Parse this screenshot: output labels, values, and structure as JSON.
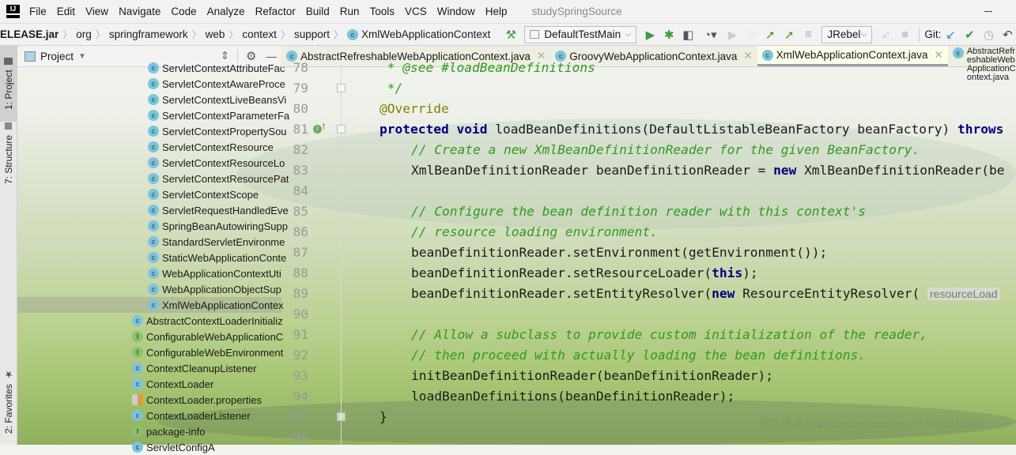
{
  "menubar": {
    "logo": "IJ",
    "items": [
      "File",
      "Edit",
      "View",
      "Navigate",
      "Code",
      "Analyze",
      "Refactor",
      "Build",
      "Run",
      "Tools",
      "VCS",
      "Window",
      "Help"
    ],
    "title": "studySpringSource"
  },
  "breadcrumb": [
    "ELEASE.jar",
    "org",
    "springframework",
    "web",
    "context",
    "support",
    "XmlWebApplicationContext"
  ],
  "toolbar": {
    "run_config": "DefaultTestMain",
    "jrebel": "JRebel",
    "git_label": "Git:",
    "icons": [
      "build-hammer-icon",
      "run-icon",
      "debug-icon",
      "coverage-icon",
      "profile-icon",
      "run-disabled-icon",
      "attach-icon",
      "jrebel-run-icon",
      "jrebel-debug-icon",
      "step-icon",
      "jrebel-rocket-icon",
      "stop-icon",
      "git-update-icon",
      "git-commit-icon",
      "history-icon",
      "rollback-icon"
    ]
  },
  "sidebar": {
    "tabs": [
      "1: Project",
      "7: Structure",
      "2: Favorites"
    ]
  },
  "project_panel": {
    "title": "Project",
    "tree": [
      {
        "label": "ServletContextAttributeFac",
        "type": "class",
        "level": 2
      },
      {
        "label": "ServletContextAwareProce",
        "type": "class",
        "level": 2
      },
      {
        "label": "ServletContextLiveBeansVi",
        "type": "class",
        "level": 2
      },
      {
        "label": "ServletContextParameterFa",
        "type": "class",
        "level": 2
      },
      {
        "label": "ServletContextPropertySou",
        "type": "class",
        "level": 2
      },
      {
        "label": "ServletContextResource",
        "type": "class",
        "level": 2
      },
      {
        "label": "ServletContextResourceLo",
        "type": "class",
        "level": 2
      },
      {
        "label": "ServletContextResourcePat",
        "type": "class",
        "level": 2
      },
      {
        "label": "ServletContextScope",
        "type": "class",
        "level": 2
      },
      {
        "label": "ServletRequestHandledEve",
        "type": "class",
        "level": 2
      },
      {
        "label": "SpringBeanAutowiringSupp",
        "type": "class",
        "level": 2
      },
      {
        "label": "StandardServletEnvironme",
        "type": "class",
        "level": 2
      },
      {
        "label": "StaticWebApplicationConte",
        "type": "class",
        "level": 2
      },
      {
        "label": "WebApplicationContextUti",
        "type": "class",
        "level": 2
      },
      {
        "label": "WebApplicationObjectSup",
        "type": "class",
        "level": 2
      },
      {
        "label": "XmlWebApplicationContex",
        "type": "class",
        "level": 2,
        "selected": true
      },
      {
        "label": "AbstractContextLoaderInitializ",
        "type": "class",
        "level": 1
      },
      {
        "label": "ConfigurableWebApplicationC",
        "type": "interface",
        "level": 1
      },
      {
        "label": "ConfigurableWebEnvironment",
        "type": "interface",
        "level": 1
      },
      {
        "label": "ContextCleanupListener",
        "type": "class",
        "level": 1
      },
      {
        "label": "ContextLoader",
        "type": "class",
        "level": 1
      },
      {
        "label": "ContextLoader.properties",
        "type": "properties",
        "level": 1
      },
      {
        "label": "ContextLoaderListener",
        "type": "class",
        "level": 1
      },
      {
        "label": "package-info",
        "type": "interface",
        "level": 1
      },
      {
        "label": "ServletConfigA",
        "type": "class",
        "level": 1
      }
    ]
  },
  "editor_tabs": [
    {
      "label": "AbstractRefreshableWebApplicationContext.java",
      "active": false
    },
    {
      "label": "GroovyWebApplicationContext.java",
      "active": false
    },
    {
      "label": "XmlWebApplicationContext.java",
      "active": true
    },
    {
      "label": "AbstractRefreshableWebApplicationContext.java",
      "active": false
    }
  ],
  "code": [
    {
      "n": "78",
      "ind": 1,
      "tokens": [
        [
          " * ",
          "doc"
        ],
        [
          "@see",
          "doc"
        ],
        [
          " #loadBeanDefinitions",
          "doc"
        ]
      ]
    },
    {
      "n": "79",
      "ind": 1,
      "tokens": [
        [
          " */",
          "doc"
        ]
      ]
    },
    {
      "n": "80",
      "ind": 1,
      "tokens": [
        [
          "@Override",
          "an"
        ]
      ]
    },
    {
      "n": "81",
      "ind": 1,
      "tokens": [
        [
          "protected",
          "kw"
        ],
        [
          " ",
          ""
        ],
        [
          "void",
          "kw"
        ],
        [
          " loadBeanDefinitions(DefaultListableBeanFactory beanFactory) ",
          ""
        ],
        [
          "throws",
          "kw"
        ]
      ]
    },
    {
      "n": "82",
      "ind": 2,
      "tokens": [
        [
          "// Create a new XmlBeanDefinitionReader for the given BeanFactory.",
          "cm"
        ]
      ]
    },
    {
      "n": "83",
      "ind": 2,
      "tokens": [
        [
          "XmlBeanDefinitionReader beanDefinitionReader = ",
          ""
        ],
        [
          "new",
          "kw"
        ],
        [
          " XmlBeanDefinitionReader(be",
          ""
        ]
      ]
    },
    {
      "n": "84",
      "ind": 2,
      "tokens": []
    },
    {
      "n": "85",
      "ind": 2,
      "tokens": [
        [
          "// Configure the bean definition reader with this context's",
          "cm"
        ]
      ]
    },
    {
      "n": "86",
      "ind": 2,
      "tokens": [
        [
          "// resource loading environment.",
          "cm"
        ]
      ]
    },
    {
      "n": "87",
      "ind": 2,
      "tokens": [
        [
          "beanDefinitionReader.setEnvironment(getEnvironment());",
          ""
        ]
      ]
    },
    {
      "n": "88",
      "ind": 2,
      "tokens": [
        [
          "beanDefinitionReader.setResourceLoader(",
          ""
        ],
        [
          "this",
          "kw"
        ],
        [
          ");",
          ""
        ]
      ]
    },
    {
      "n": "89",
      "ind": 2,
      "tokens": [
        [
          "beanDefinitionReader.setEntityResolver(",
          ""
        ],
        [
          "new",
          "kw"
        ],
        [
          " ResourceEntityResolver( ",
          ""
        ],
        [
          "resourceLoad",
          "hint"
        ]
      ]
    },
    {
      "n": "90",
      "ind": 2,
      "tokens": []
    },
    {
      "n": "91",
      "ind": 2,
      "tokens": [
        [
          "// Allow a subclass to provide custom initialization of the reader,",
          "cm"
        ]
      ]
    },
    {
      "n": "92",
      "ind": 2,
      "tokens": [
        [
          "// then proceed with actually loading the bean definitions.",
          "cm"
        ]
      ]
    },
    {
      "n": "93",
      "ind": 2,
      "tokens": [
        [
          "initBeanDefinitionReader(beanDefinitionReader);",
          ""
        ]
      ]
    },
    {
      "n": "94",
      "ind": 2,
      "tokens": [
        [
          "loadBeanDefinitions(beanDefinitionReader);",
          ""
        ]
      ]
    },
    {
      "n": "95",
      "ind": 1,
      "tokens": [
        [
          "}",
          ""
        ]
      ]
    },
    {
      "n": "96",
      "ind": 1,
      "tokens": []
    }
  ],
  "watermark": "图片来源:https://gitee.com/jyq_18792721831/",
  "colors": {
    "keyword": "#000080",
    "comment": "#2e9a1d",
    "annotation": "#808000",
    "class_icon": "#7ec3dc",
    "interface_icon": "#8bc26b"
  }
}
